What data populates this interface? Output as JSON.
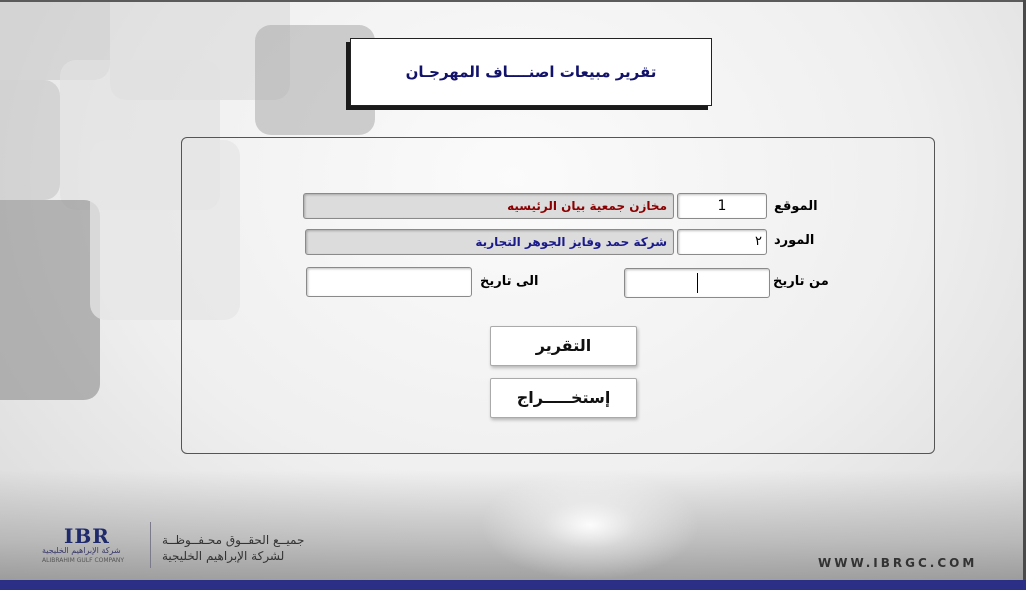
{
  "title": "تقرير مبيعات اصنــــاف المهرجـان",
  "form": {
    "location_label": "الموقع",
    "location_code": "1",
    "location_name": "مخازن جمعية بيان الرئيسيه",
    "supplier_label": "المورد",
    "supplier_code": "٢",
    "supplier_name": "شركة حمد وفايز الجوهر التجارية",
    "from_date_label": "من تاريخ",
    "from_date_value": "",
    "to_date_label": "الى تاريخ",
    "to_date_value": ""
  },
  "buttons": {
    "report": "التقرير",
    "exit": "إستخـــــراج"
  },
  "footer": {
    "logo_text": "IBR",
    "logo_arabic": "شركة الإبراهيم الخليجية",
    "logo_english": "ALIBRAHIM GULF COMPANY",
    "rights_line1": "جميــع الحقــوق محـفــوظــة",
    "rights_line2": "لشركة الإبراهيم الخليجية",
    "website": "WWW.IBRGC.COM"
  },
  "colors": {
    "title_text": "#12126b",
    "location_name_text": "#8b0000",
    "supplier_name_text": "#1a1a8c",
    "bottom_strip": "#2b2f86"
  }
}
